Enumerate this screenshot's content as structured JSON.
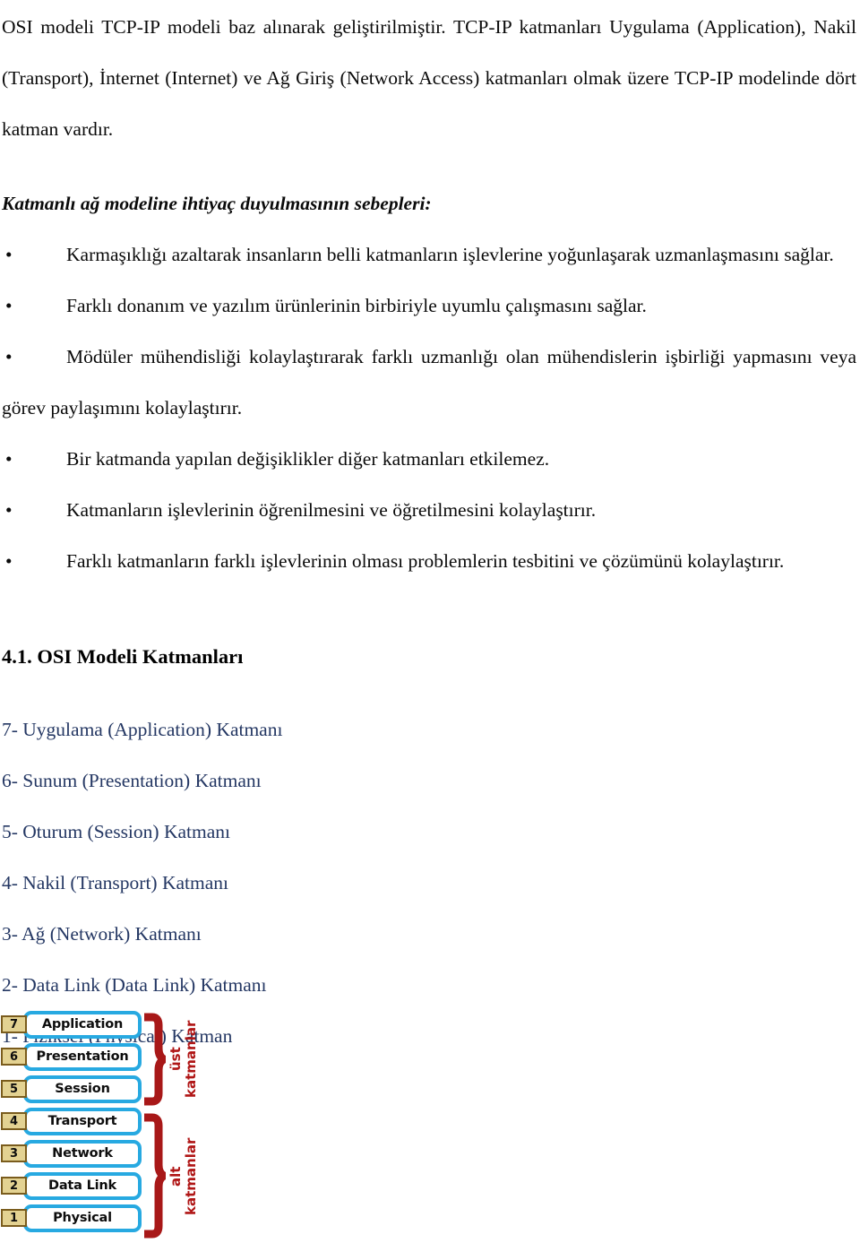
{
  "document": {
    "paragraphs": [
      "OSI modeli TCP-IP modeli baz alınarak geliştirilmiştir. TCP-IP katmanları Uygulama (Application), Nakil (Transport), İnternet (Internet) ve Ağ Giriş (Network Access) katmanları olmak üzere TCP-IP modelinde dört katman vardır."
    ],
    "italic_heading": "Katmanlı ağ modeline ihtiyaç duyulmasının sebepleri:",
    "bullets": [
      "Karmaşıklığı azaltarak insanların belli katmanların işlevlerine yoğunlaşarak uzmanlaşmasını sağlar.",
      "Farklı donanım ve yazılım ürünlerinin birbiriyle uyumlu çalışmasını sağlar.",
      "Mödüler mühendisliği kolaylaştırarak farklı uzmanlığı olan mühendislerin işbirliği yapmasını veya görev paylaşımını kolaylaştırır.",
      "Bir katmanda yapılan değişiklikler diğer katmanları etkilemez.",
      "Katmanların işlevlerinin öğrenilmesini ve öğretilmesini kolaylaştırır.",
      "Farklı katmanların farklı işlevlerinin olması problemlerin tesbitini ve çözümünü kolaylaştırır."
    ],
    "bullet_glyph": "•",
    "section_heading": "4.1. OSI Modeli Katmanları",
    "layer_list": [
      "7- Uygulama (Application) Katmanı",
      "6- Sunum (Presentation) Katmanı",
      "5- Oturum (Session) Katmanı",
      "4- Nakil (Transport) Katmanı",
      "3- Ağ (Network) Katmanı",
      "2- Data Link (Data Link) Katmanı",
      "1- Fiziksel (Physical) Katman"
    ],
    "layer_list_color": "#243763"
  },
  "diagram": {
    "name": "osi-layer-stack-diagram",
    "bars": [
      {
        "number": "7",
        "label": "Application"
      },
      {
        "number": "6",
        "label": "Presentation"
      },
      {
        "number": "5",
        "label": "Session"
      },
      {
        "number": "4",
        "label": "Transport"
      },
      {
        "number": "3",
        "label": "Network"
      },
      {
        "number": "2",
        "label": "Data Link"
      },
      {
        "number": "1",
        "label": "Physical"
      }
    ],
    "groups": [
      {
        "label": "üst\nkatmanlar",
        "covers": "7-5"
      },
      {
        "label": "alt\nkatmanlar",
        "covers": "4-1"
      }
    ],
    "colors": {
      "bar_border": "#27a9e1",
      "bar_fill": "#ffffff",
      "number_fill": "#e3d292",
      "number_border": "#7a5c1d",
      "brace": "#a81818",
      "group_label": "#b01616"
    }
  }
}
